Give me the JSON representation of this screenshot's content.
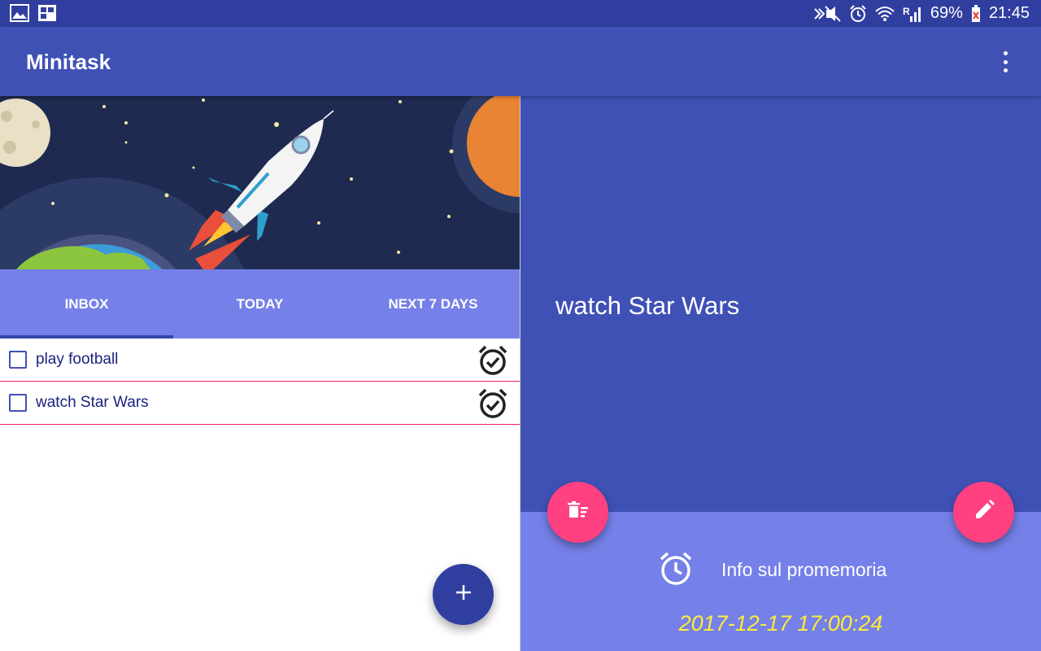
{
  "status_bar": {
    "battery": "69%",
    "time": "21:45"
  },
  "app_bar": {
    "title": "Minitask"
  },
  "tabs": [
    {
      "label": "INBOX",
      "active": true
    },
    {
      "label": "TODAY",
      "active": false
    },
    {
      "label": "NEXT 7 DAYS",
      "active": false
    }
  ],
  "tasks": [
    {
      "label": "play football",
      "checked": false
    },
    {
      "label": "watch Star Wars",
      "checked": false
    }
  ],
  "detail": {
    "title": "watch Star Wars",
    "reminder_label": "Info sul promemoria",
    "reminder_date": "2017-12-17 17:00:24"
  },
  "colors": {
    "primary": "#3F51B5",
    "primary_dark": "#303F9F",
    "accent": "#FF4081",
    "tab_bg": "#7580E8",
    "date_text": "#FFEB3B",
    "row_divider": "#E91E63"
  },
  "icons": {
    "status_left": [
      "image-icon",
      "gallery-icon"
    ],
    "status_right": [
      "nfc-muted-icon",
      "alarm-icon",
      "wifi-icon",
      "signal-icon",
      "battery-icon"
    ],
    "task_row": "alarm-clock-check-icon",
    "fab_add": "plus-icon",
    "fab_delete": "delete-sweep-icon",
    "fab_edit": "pencil-icon",
    "reminder": "alarm-icon"
  }
}
